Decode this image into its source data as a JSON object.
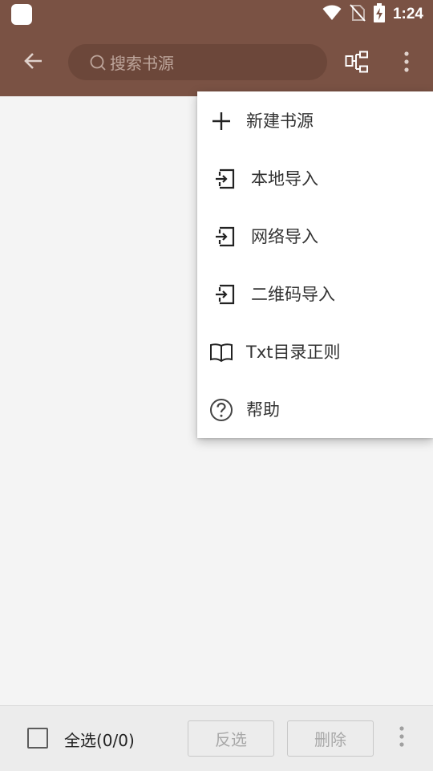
{
  "status_bar": {
    "time": "1:24",
    "icons": [
      "app-icon",
      "wifi-icon",
      "no-sim-icon",
      "battery-charging-icon"
    ]
  },
  "toolbar": {
    "back_icon": "arrow-left-icon",
    "search_placeholder": "搜索书源",
    "group_icon": "group-icon",
    "more_icon": "more-vert-icon"
  },
  "menu": {
    "items": [
      {
        "label": "新建书源",
        "icon": "plus-icon"
      },
      {
        "label": "本地导入",
        "icon": "import-icon"
      },
      {
        "label": "网络导入",
        "icon": "import-icon"
      },
      {
        "label": "二维码导入",
        "icon": "import-icon"
      },
      {
        "label": "Txt目录正则",
        "icon": "book-icon"
      },
      {
        "label": "帮助",
        "icon": "help-icon"
      }
    ]
  },
  "bottom_bar": {
    "select_all": "全选(0/0)",
    "invert_button": "反选",
    "delete_button": "删除",
    "more_icon": "more-vert-icon"
  },
  "colors": {
    "toolbar": "#7a5244",
    "search_bg": "#6c473a",
    "background": "#f4f4f4"
  }
}
